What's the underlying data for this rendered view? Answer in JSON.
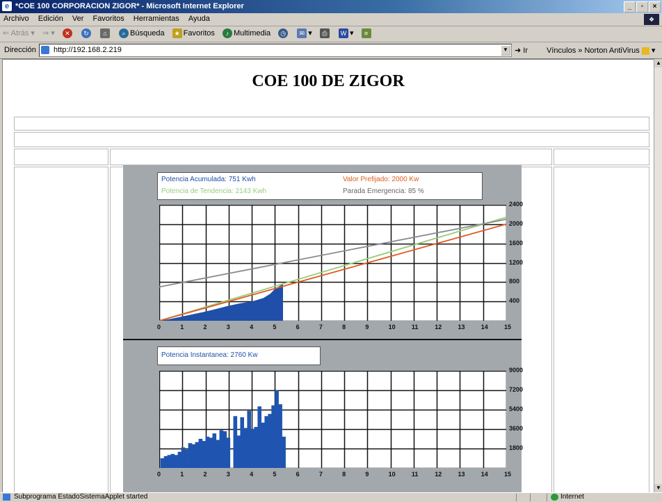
{
  "window": {
    "title": "*COE 100 CORPORACION ZIGOR* - Microsoft Internet Explorer",
    "min_label": "_",
    "max_label": "▫",
    "close_label": "×"
  },
  "menubar": [
    "Archivo",
    "Edición",
    "Ver",
    "Favoritos",
    "Herramientas",
    "Ayuda"
  ],
  "toolbar": {
    "back": "Atrás",
    "search": "Búsqueda",
    "favorites": "Favoritos",
    "multimedia": "Multimedia"
  },
  "address": {
    "label": "Dirección",
    "url": "http://192.168.2.219",
    "go": "Ir",
    "links": "Vínculos",
    "norton": "Norton AntiVirus"
  },
  "page": {
    "title": "COE 100 DE ZIGOR"
  },
  "chart1": {
    "legend": {
      "acumulada": "Potencia Acumulada: 751 Kwh",
      "tendencia": "Potencia de Tendencia: 2143 Kwh",
      "prefijado": "Valor Prefijado: 2000 Kw",
      "emergencia": "Parada Emergencia: 85 %"
    },
    "y_ticks": [
      "2400",
      "2000",
      "1600",
      "1200",
      "800",
      "400"
    ],
    "x_ticks": [
      "0",
      "1",
      "2",
      "3",
      "4",
      "5",
      "6",
      "7",
      "8",
      "9",
      "10",
      "11",
      "12",
      "13",
      "14",
      "15"
    ]
  },
  "chart2": {
    "legend": {
      "instantanea": "Potencia Instantanea: 2760 Kw"
    },
    "y_ticks": [
      "9000",
      "7200",
      "5400",
      "3600",
      "1800"
    ],
    "x_ticks": [
      "0",
      "1",
      "2",
      "3",
      "4",
      "5",
      "6",
      "7",
      "8",
      "9",
      "10",
      "11",
      "12",
      "13",
      "14",
      "15"
    ]
  },
  "chart_data": [
    {
      "type": "line",
      "ylim": [
        0,
        2400
      ],
      "xlim": [
        0,
        15
      ],
      "grid": true,
      "series": [
        {
          "name": "Potencia Acumulada",
          "color": "#1f4fa8",
          "kind": "area",
          "x": [
            0,
            0.5,
            1,
            1.5,
            2,
            2.5,
            3,
            3.5,
            4,
            4.5,
            4.8,
            5,
            5.2,
            5.35,
            5.35
          ],
          "y": [
            0,
            40,
            90,
            140,
            190,
            250,
            310,
            360,
            400,
            470,
            560,
            660,
            720,
            760,
            0
          ]
        },
        {
          "name": "Potencia de Tendencia",
          "color": "#9acb7a",
          "x": [
            0,
            15
          ],
          "y": [
            0,
            2143
          ]
        },
        {
          "name": "Valor Prefijado",
          "color": "#e05a20",
          "x": [
            0,
            15
          ],
          "y": [
            0,
            2000
          ]
        },
        {
          "name": "Parada Emergencia",
          "color": "#8a8a90",
          "x": [
            0,
            15
          ],
          "y": [
            700,
            2100
          ]
        }
      ]
    },
    {
      "type": "bar",
      "ylim": [
        0,
        9000
      ],
      "xlim": [
        0,
        15
      ],
      "grid": true,
      "series": [
        {
          "name": "Potencia Instantanea",
          "color": "#1f55b0",
          "x": [
            0.05,
            0.2,
            0.35,
            0.5,
            0.65,
            0.8,
            0.95,
            1.1,
            1.25,
            1.4,
            1.55,
            1.7,
            1.85,
            2.0,
            2.15,
            2.3,
            2.45,
            2.6,
            2.75,
            2.9,
            3.05,
            3.2,
            3.35,
            3.5,
            3.65,
            3.8,
            3.95,
            4.1,
            4.25,
            4.4,
            4.55,
            4.7,
            4.85,
            5.0,
            5.15,
            5.3
          ],
          "y": [
            900,
            1100,
            1200,
            1300,
            1200,
            1500,
            1900,
            1700,
            2300,
            2200,
            2400,
            2700,
            2500,
            2900,
            2800,
            3200,
            2600,
            3500,
            3400,
            2800,
            0,
            4800,
            3000,
            4700,
            3700,
            5300,
            3600,
            3800,
            5700,
            4200,
            4800,
            5000,
            5800,
            7200,
            5900,
            2900
          ]
        }
      ]
    }
  ],
  "status": {
    "text": "Subprograma EstadoSistemaApplet started",
    "zone": "Internet"
  }
}
